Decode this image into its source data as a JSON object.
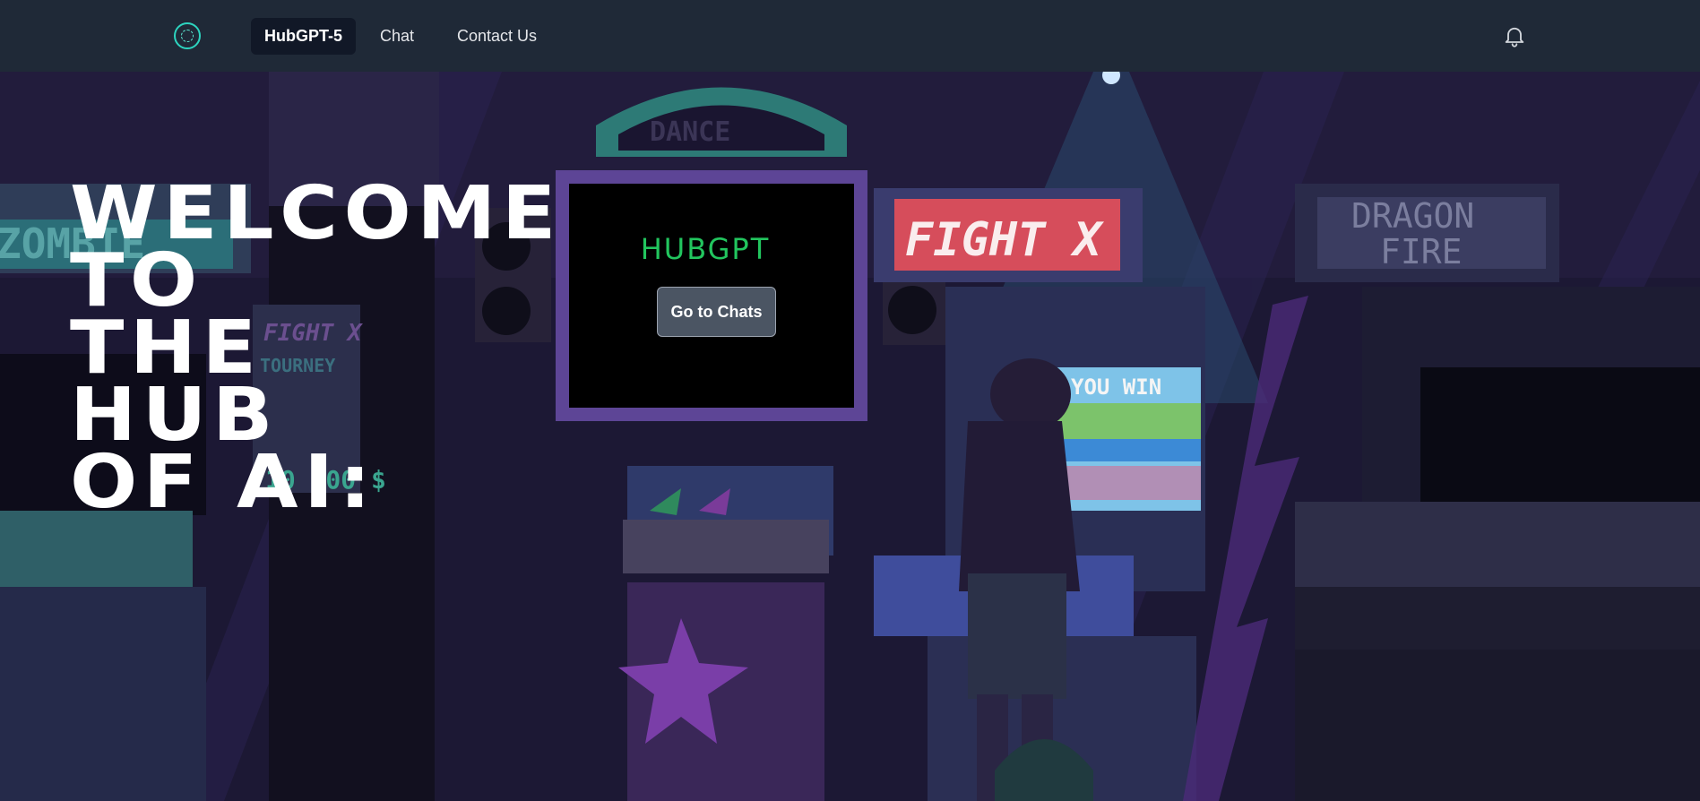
{
  "nav": {
    "links": [
      "HubGPT-5",
      "Chat",
      "Contact Us"
    ]
  },
  "hero": {
    "welcome": "WELCOME\nTO\nTHE\nHUB\nOF AI:"
  },
  "screen": {
    "title": "HUBGPT",
    "button": "Go to Chats"
  },
  "signs": {
    "dance": "DANCE",
    "fight": "FIGHT X",
    "dragon": "DRAGON\nFIRE",
    "zombie": "ZOMBIE",
    "tourney": "FIGHT X\nTOURNEY",
    "prize": "10 000 $",
    "youwin": "YOU WIN"
  },
  "colors": {
    "nav_bg": "#1f2937",
    "accent_green": "#22c55e",
    "logo_teal": "#2dd4bf"
  }
}
